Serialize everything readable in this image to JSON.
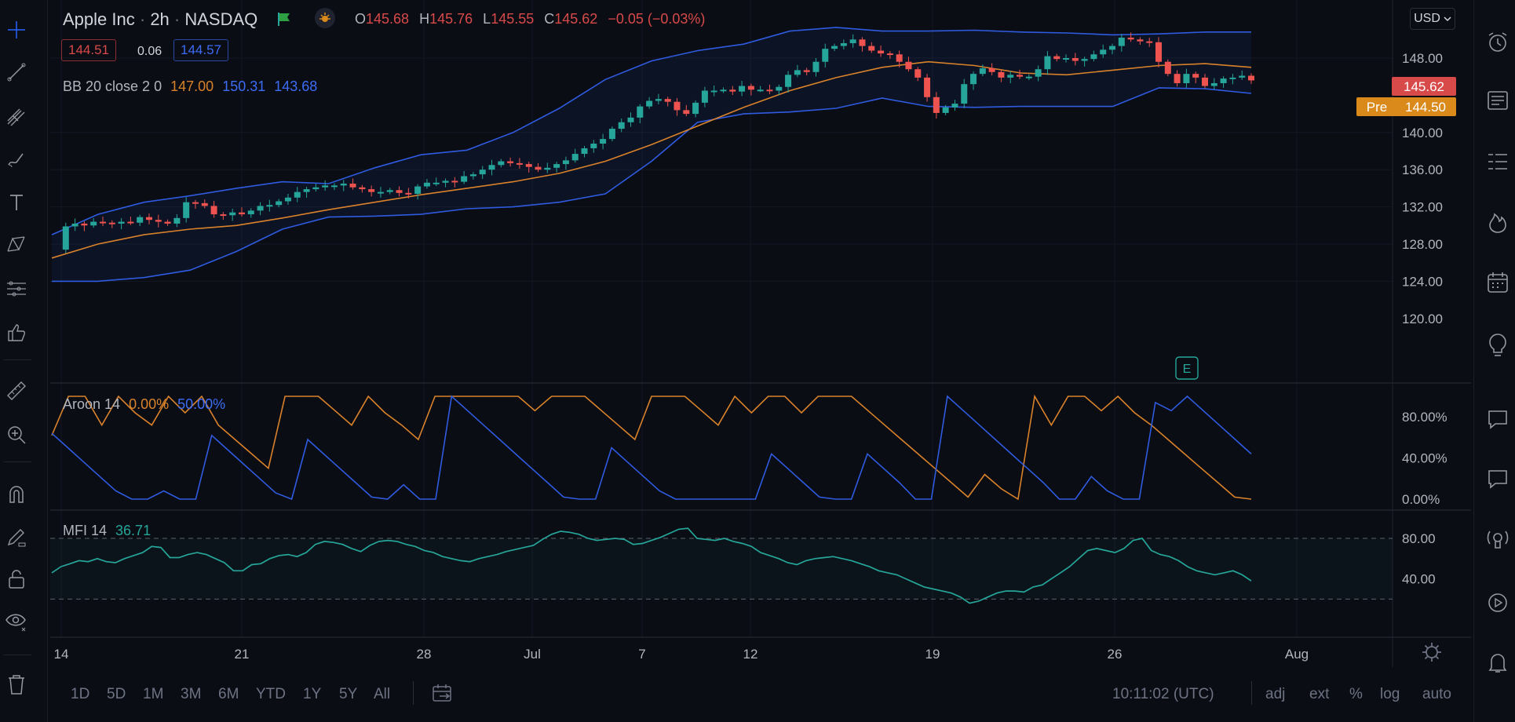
{
  "symbol": {
    "name": "Apple Inc",
    "interval": "2h",
    "exchange": "NASDAQ",
    "sep": "·"
  },
  "ohlc": {
    "o_label": "O",
    "o": "145.68",
    "h_label": "H",
    "h": "145.76",
    "l_label": "L",
    "l": "145.55",
    "c_label": "C",
    "c": "145.62",
    "change": "−0.05 (−0.03%)"
  },
  "bidask": {
    "bid": "144.51",
    "spread": "0.06",
    "ask": "144.57"
  },
  "bb": {
    "label": "BB 20 close 2 0",
    "basis": "147.00",
    "upper": "150.31",
    "lower": "143.68"
  },
  "aroon_legend": {
    "label": "Aroon 14",
    "up": "0.00%",
    "down": "50.00%"
  },
  "mfi_legend": {
    "label": "MFI 14",
    "value": "36.71"
  },
  "currency": "USD",
  "price_axis": {
    "ticks": [
      "148.00",
      "140.00",
      "136.00",
      "132.00",
      "128.00",
      "124.00",
      "120.00"
    ]
  },
  "price_tags": {
    "last": "145.62",
    "pre_label": "Pre",
    "pre": "144.50"
  },
  "aroon_axis": {
    "ticks": [
      "80.00%",
      "40.00%",
      "0.00%"
    ]
  },
  "mfi_axis": {
    "ticks": [
      "80.00",
      "40.00"
    ]
  },
  "earnings_label": "E",
  "time_axis": {
    "labels": [
      "14",
      "21",
      "28",
      "Jul",
      "7",
      "12",
      "19",
      "26",
      "Aug"
    ]
  },
  "ranges": [
    "1D",
    "5D",
    "1M",
    "3M",
    "6M",
    "YTD",
    "1Y",
    "5Y",
    "All"
  ],
  "clock": "10:11:02 (UTC)",
  "options": [
    "adj",
    "ext",
    "%",
    "log",
    "auto"
  ],
  "colors": {
    "up": "#26a69a",
    "down": "#ef5350",
    "bb_basis": "#e08a26",
    "bb_band": "#2962ff",
    "aroon_up": "#e08a26",
    "aroon_down": "#2962ff",
    "mfi": "#26a69a"
  },
  "icons": {
    "left": [
      "crosshair-icon",
      "trend-line-icon",
      "pitchfork-icon",
      "brush-icon",
      "text-icon",
      "pattern-icon",
      "prediction-icon",
      "thumbs-up-icon",
      "ruler-icon",
      "zoom-in-icon",
      "magnet-icon",
      "lock-pencil-icon",
      "lock-icon",
      "eye-icon",
      "trash-icon"
    ],
    "right": [
      "alarm-clock-icon",
      "news-icon",
      "watchlist-icon",
      "hotlist-icon",
      "calendar-icon",
      "ideas-icon",
      "chat-icon",
      "chat-bubble-icon",
      "streams-icon",
      "replay-icon",
      "bell-icon"
    ]
  },
  "chart_data": [
    {
      "type": "candlestick",
      "title": "Apple Inc · 2h · NASDAQ",
      "x_axis_labels": [
        "14",
        "21",
        "28",
        "Jul",
        "7",
        "12",
        "19",
        "26",
        "Aug"
      ],
      "y_range": [
        120,
        150
      ],
      "close_series": [
        127.4,
        129.9,
        130.2,
        130.0,
        130.4,
        130.3,
        130.2,
        130.4,
        130.3,
        130.9,
        130.6,
        130.4,
        130.2,
        130.8,
        132.5,
        132.4,
        132.1,
        131.2,
        131.1,
        131.4,
        131.2,
        131.6,
        132.1,
        132.2,
        132.6,
        133.0,
        133.6,
        133.9,
        134.1,
        134.3,
        134.3,
        134.5,
        134.1,
        133.9,
        133.6,
        133.6,
        133.8,
        133.5,
        133.4,
        134.2,
        134.6,
        134.6,
        134.8,
        134.7,
        135.3,
        135.5,
        136.0,
        136.5,
        136.9,
        136.7,
        136.6,
        136.3,
        136.0,
        136.2,
        136.6,
        137.0,
        137.7,
        138.3,
        138.8,
        139.3,
        140.4,
        141.1,
        141.6,
        142.8,
        143.4,
        143.6,
        143.3,
        142.4,
        142.0,
        143.2,
        144.5,
        144.5,
        144.6,
        144.4,
        145.0,
        144.6,
        144.6,
        144.5,
        144.9,
        146.2,
        146.7,
        146.5,
        147.6,
        149.0,
        149.3,
        149.6,
        150.0,
        149.3,
        148.8,
        148.5,
        148.4,
        147.6,
        146.8,
        145.9,
        143.8,
        142.1,
        142.7,
        143.1,
        145.2,
        146.3,
        146.9,
        146.5,
        145.9,
        146.2,
        146.0,
        146.0,
        146.8,
        148.2,
        147.9,
        148.0,
        147.7,
        147.9,
        148.4,
        148.9,
        149.3,
        150.2,
        150.0,
        149.8,
        149.7,
        147.6,
        146.3,
        145.3,
        146.3,
        145.9,
        145.0,
        145.3,
        145.8,
        145.9,
        146.1,
        145.6
      ],
      "bb_basis": [
        126.5,
        128.0,
        129.0,
        129.6,
        130.0,
        130.8,
        131.7,
        132.5,
        133.3,
        134.0,
        134.7,
        135.6,
        136.9,
        138.7,
        140.7,
        142.7,
        144.5,
        145.9,
        147.0,
        147.6,
        147.2,
        146.4,
        146.2,
        146.7,
        147.2,
        147.4,
        147.0
      ],
      "bb_upper": [
        129.0,
        131.2,
        132.5,
        133.2,
        134.0,
        134.7,
        134.5,
        136.2,
        137.6,
        138.1,
        140.0,
        142.6,
        145.7,
        147.7,
        148.8,
        149.5,
        150.9,
        151.3,
        150.9,
        150.9,
        151.0,
        150.8,
        150.7,
        150.5,
        150.6,
        150.8,
        150.8
      ],
      "bb_lower": [
        124.0,
        124.0,
        124.4,
        125.2,
        127.2,
        129.6,
        130.9,
        131.0,
        131.2,
        131.8,
        132.0,
        132.5,
        133.4,
        136.9,
        141.1,
        142.0,
        142.2,
        142.6,
        143.7,
        142.8,
        142.7,
        142.8,
        142.8,
        142.8,
        144.8,
        144.7,
        144.2
      ]
    },
    {
      "type": "line",
      "title": "Aroon 14",
      "y_range": [
        0,
        100
      ],
      "series": [
        {
          "name": "Up",
          "values": [
            62,
            100,
            100,
            72,
            100,
            84,
            72,
            100,
            84,
            100,
            72,
            58,
            44,
            30,
            100,
            100,
            100,
            86,
            72,
            100,
            84,
            72,
            58,
            100,
            100,
            100,
            100,
            100,
            100,
            86,
            100,
            100,
            100,
            86,
            72,
            58,
            100,
            100,
            100,
            86,
            72,
            100,
            84,
            100,
            100,
            84,
            100,
            100,
            100,
            86,
            72,
            58,
            44,
            30,
            16,
            2,
            24,
            10,
            0,
            100,
            72,
            100,
            100,
            86,
            100,
            84,
            72,
            58,
            44,
            30,
            16,
            2,
            0
          ]
        },
        {
          "name": "Down",
          "values": [
            64,
            50,
            36,
            22,
            8,
            0,
            0,
            8,
            0,
            0,
            62,
            48,
            34,
            20,
            6,
            0,
            58,
            44,
            30,
            16,
            2,
            0,
            14,
            0,
            0,
            100,
            86,
            72,
            58,
            44,
            30,
            16,
            2,
            0,
            0,
            50,
            36,
            22,
            8,
            0,
            0,
            0,
            0,
            0,
            0,
            44,
            30,
            16,
            2,
            0,
            0,
            44,
            30,
            16,
            0,
            0,
            100,
            86,
            72,
            58,
            44,
            30,
            16,
            0,
            0,
            22,
            8,
            0,
            0,
            94,
            86,
            100,
            86,
            72,
            58,
            44
          ]
        }
      ]
    },
    {
      "type": "line",
      "title": "MFI 14",
      "y_range": [
        0,
        100
      ],
      "levels": [
        80,
        20
      ],
      "series": [
        {
          "name": "MFI",
          "values": [
            46,
            52,
            55,
            58,
            57,
            60,
            57,
            56,
            60,
            63,
            66,
            72,
            71,
            61,
            61,
            64,
            66,
            64,
            60,
            56,
            48,
            48,
            54,
            55,
            60,
            63,
            64,
            62,
            66,
            74,
            77,
            76,
            74,
            70,
            67,
            73,
            77,
            78,
            77,
            74,
            72,
            68,
            66,
            62,
            60,
            58,
            57,
            60,
            62,
            64,
            67,
            69,
            71,
            73,
            79,
            84,
            87,
            86,
            84,
            80,
            78,
            79,
            80,
            79,
            74,
            75,
            78,
            81,
            85,
            89,
            90,
            80,
            79,
            78,
            80,
            77,
            75,
            72,
            66,
            63,
            60,
            56,
            54,
            58,
            60,
            61,
            62,
            60,
            58,
            55,
            52,
            48,
            46,
            44,
            40,
            36,
            32,
            30,
            28,
            26,
            22,
            16,
            18,
            22,
            26,
            28,
            28,
            27,
            32,
            34,
            40,
            46,
            52,
            60,
            68,
            70,
            68,
            66,
            70,
            78,
            80,
            68,
            64,
            62,
            58,
            52,
            48,
            46,
            44,
            46,
            48,
            44,
            38
          ]
        }
      ]
    }
  ]
}
